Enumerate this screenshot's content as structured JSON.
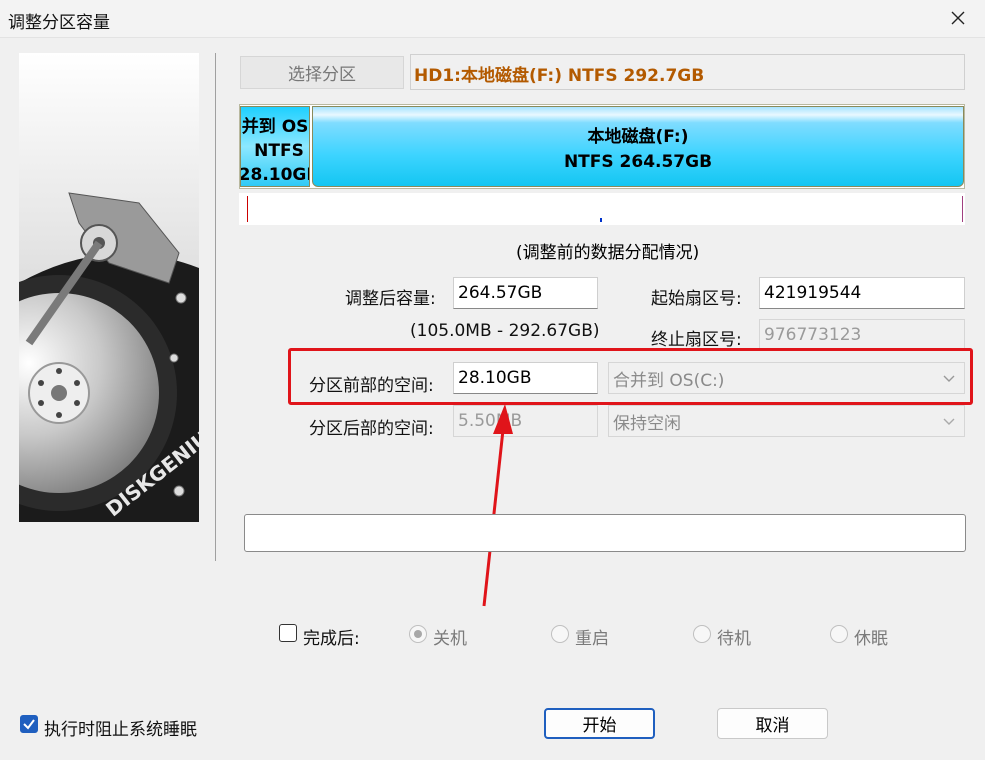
{
  "window": {
    "title": "调整分区容量"
  },
  "select_partition_button": "选择分区",
  "disk_title": "HD1:本地磁盘(F:) NTFS 292.7GB",
  "partition_bar": {
    "os_partition": {
      "lines": [
        "并到 OS(",
        "NTFS",
        "28.10GB"
      ]
    },
    "f_partition": {
      "lines": [
        "本地磁盘(F:)",
        "NTFS 264.57GB"
      ]
    }
  },
  "caption": "(调整前的数据分配情况)",
  "form": {
    "new_size_label": "调整后容量:",
    "new_size_value": "264.57GB",
    "range_text": "(105.0MB - 292.67GB)",
    "start_sector_label": "起始扇区号:",
    "start_sector_value": "421919544",
    "end_sector_label": "终止扇区号:",
    "end_sector_value": "976773123",
    "before_space_label": "分区前部的空间:",
    "before_space_value": "28.10GB",
    "before_action": "合并到 OS(C:)",
    "after_space_label": "分区后部的空间:",
    "after_space_value": "5.50MB",
    "after_action": "保持空闲"
  },
  "after_completion": {
    "label": "完成后:",
    "options": [
      "关机",
      "重启",
      "待机",
      "休眠"
    ],
    "selected": "关机"
  },
  "prevent_sleep_label": "执行时阻止系统睡眠",
  "buttons": {
    "start": "开始",
    "cancel": "取消"
  },
  "side_image_brand": "DISKGENIUS",
  "colors": {
    "annotation_red": "#e0141a",
    "partition_cyan": "#14c6f2",
    "disk_title": "#b35a00"
  }
}
